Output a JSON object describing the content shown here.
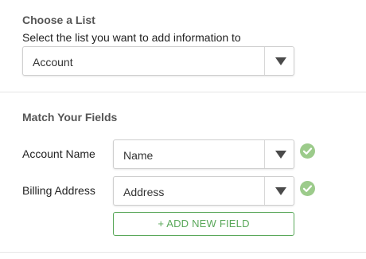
{
  "choose_list": {
    "title": "Choose a List",
    "subtitle": "Select the list you want to add information to",
    "selected": "Account"
  },
  "match_fields": {
    "title": "Match Your Fields",
    "rows": [
      {
        "label": "Account Name",
        "selected": "Name",
        "status": "matched"
      },
      {
        "label": "Billing Address",
        "selected": "Address",
        "status": "matched"
      }
    ],
    "add_button_label": "+ ADD NEW FIELD"
  },
  "colors": {
    "check": "#9ccb8b",
    "accent_green": "#5aa85a",
    "caret": "#4a4a4a"
  },
  "icons": {
    "dropdown": "caret-down-icon",
    "status": "check-circle-icon"
  }
}
